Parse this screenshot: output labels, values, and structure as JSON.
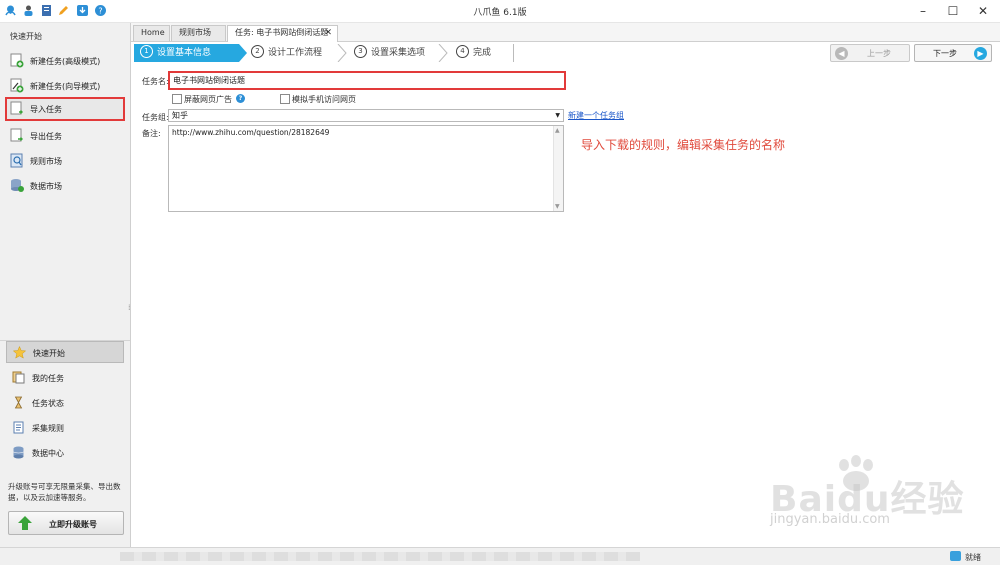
{
  "window": {
    "title": "八爪鱼 6.1版",
    "minimize": "–",
    "maximize": "☐",
    "close": "✕"
  },
  "sidebar": {
    "header": "快速开始",
    "items": [
      {
        "label": "新建任务(高级模式)",
        "icon": "new-task-advanced-icon"
      },
      {
        "label": "新建任务(向导模式)",
        "icon": "new-task-wizard-icon"
      },
      {
        "label": "导入任务",
        "icon": "import-task-icon"
      },
      {
        "label": "导出任务",
        "icon": "export-task-icon"
      },
      {
        "label": "规则市场",
        "icon": "rule-market-icon"
      },
      {
        "label": "数据市场",
        "icon": "data-market-icon"
      }
    ],
    "nav": [
      {
        "label": "快速开始",
        "icon": "star-icon"
      },
      {
        "label": "我的任务",
        "icon": "my-tasks-icon"
      },
      {
        "label": "任务状态",
        "icon": "hourglass-icon"
      },
      {
        "label": "采集规则",
        "icon": "rules-icon"
      },
      {
        "label": "数据中心",
        "icon": "database-icon"
      }
    ],
    "upgrade_text": "升级账号可享无限量采集、导出数据，以及云加速等服务。",
    "upgrade_button": "立即升级账号"
  },
  "tabs": [
    {
      "label": "Home"
    },
    {
      "label": "规则市场"
    },
    {
      "label": "任务: 电子书网站倒闭话题",
      "close": "✕"
    }
  ],
  "wizard": {
    "steps": [
      {
        "num": "1",
        "label": "设置基本信息"
      },
      {
        "num": "2",
        "label": "设计工作流程"
      },
      {
        "num": "3",
        "label": "设置采集选项"
      },
      {
        "num": "4",
        "label": "完成"
      }
    ],
    "prev": "上一步",
    "next": "下一步",
    "prev_glyph": "◀",
    "next_glyph": "▶"
  },
  "form": {
    "task_name_label": "任务名:",
    "task_name_value": "电子书网站倒闭话题",
    "block_ads_label": "屏蔽网页广告",
    "mobile_label": "模拟手机访问网页",
    "help_glyph": "?",
    "group_label": "任务组:",
    "group_value": "知乎",
    "group_caret": "▼",
    "new_group_link": "新建一个任务组",
    "remark_label": "备注:",
    "remark_value": "http://www.zhihu.com/question/28182649"
  },
  "annotation": "导入下载的规则，编辑采集任务的名称",
  "statusbar": {
    "status": "就绪"
  },
  "watermark": {
    "brand": "Baidu经验",
    "url": "jingyan.baidu.com"
  },
  "colors": {
    "accent": "#26a8e0",
    "highlight": "#e23a3a",
    "annotation": "#e04a3c",
    "link": "#1a56c9"
  }
}
